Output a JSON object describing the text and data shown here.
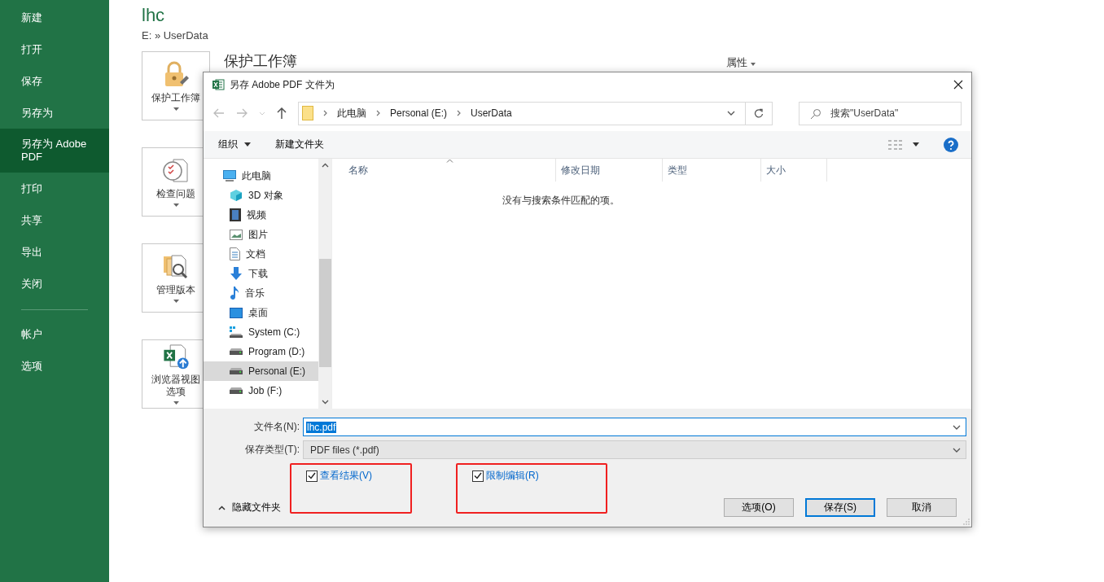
{
  "sidebar": {
    "items": [
      {
        "label": "新建",
        "selected": false
      },
      {
        "label": "打开",
        "selected": false
      },
      {
        "label": "保存",
        "selected": false
      },
      {
        "label": "另存为",
        "selected": false
      },
      {
        "label": "另存为 Adobe PDF",
        "selected": true
      },
      {
        "label": "打印",
        "selected": false
      },
      {
        "label": "共享",
        "selected": false
      },
      {
        "label": "导出",
        "selected": false
      },
      {
        "label": "关闭",
        "selected": false
      }
    ],
    "bottom_items": [
      {
        "label": "帐户",
        "selected": false
      },
      {
        "label": "选项",
        "selected": false
      }
    ]
  },
  "document": {
    "title": "lhc",
    "path": "E: » UserData",
    "properties_label": "属性",
    "heading": "保护工作簿",
    "cards": [
      {
        "kind": "lock",
        "label": "保护工作簿"
      },
      {
        "kind": "inspect",
        "label": "检查问题"
      },
      {
        "kind": "versions",
        "label": "管理版本"
      },
      {
        "kind": "browser",
        "label": "浏览器视图选项"
      }
    ]
  },
  "dialog": {
    "title": "另存 Adobe PDF 文件为",
    "breadcrumb": [
      "此电脑",
      "Personal (E:)",
      "UserData"
    ],
    "search": {
      "placeholder": "搜索\"UserData\""
    },
    "toolbar": [
      {
        "label": "组织",
        "dropdown": true
      },
      {
        "label": "新建文件夹",
        "dropdown": false
      }
    ],
    "nav_items": [
      {
        "kind": "pc",
        "label": "此电脑",
        "selected": false
      },
      {
        "kind": "cube",
        "label": "3D 对象",
        "selected": false
      },
      {
        "kind": "video",
        "label": "视频",
        "selected": false
      },
      {
        "kind": "pictures",
        "label": "图片",
        "selected": false
      },
      {
        "kind": "document",
        "label": "文档",
        "selected": false
      },
      {
        "kind": "download",
        "label": "下载",
        "selected": false
      },
      {
        "kind": "music",
        "label": "音乐",
        "selected": false
      },
      {
        "kind": "desktop",
        "label": "桌面",
        "selected": false
      },
      {
        "kind": "system-drive",
        "label": "System (C:)",
        "selected": false
      },
      {
        "kind": "drive",
        "label": "Program (D:)",
        "selected": false
      },
      {
        "kind": "drive",
        "label": "Personal (E:)",
        "selected": true
      },
      {
        "kind": "drive",
        "label": "Job (F:)",
        "selected": false
      }
    ],
    "columns": [
      "名称",
      "修改日期",
      "类型",
      "大小"
    ],
    "empty_message": "没有与搜索条件匹配的项。",
    "file_name": {
      "label": "文件名(N):",
      "value": "lhc.pdf"
    },
    "file_type": {
      "label": "保存类型(T):",
      "value": "PDF files (*.pdf)"
    },
    "checkboxes": [
      {
        "label": "查看结果(V)",
        "checked": true
      },
      {
        "label": "限制编辑(R)",
        "checked": true
      }
    ],
    "hide_folders": "隐藏文件夹",
    "buttons": [
      {
        "label": "选项(O)",
        "default": false
      },
      {
        "label": "保存(S)",
        "default": true
      },
      {
        "label": "取消",
        "default": false
      }
    ]
  }
}
